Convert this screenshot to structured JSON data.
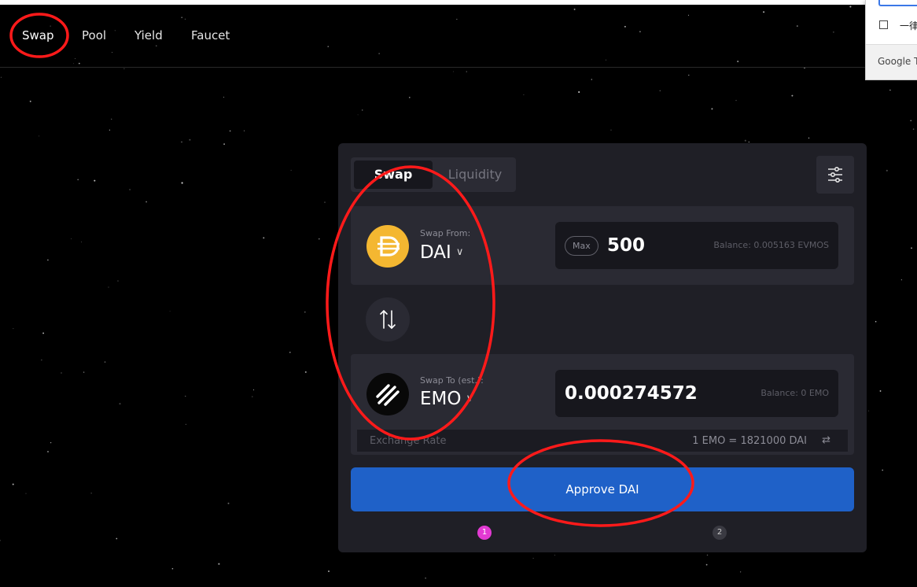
{
  "nav": {
    "items": [
      {
        "label": "Swap",
        "active": true
      },
      {
        "label": "Pool",
        "active": false
      },
      {
        "label": "Yield",
        "active": false
      },
      {
        "label": "Faucet",
        "active": false
      }
    ]
  },
  "translate_popup": {
    "checkbox_label": "一律",
    "brand": "Google Tr"
  },
  "swap_card": {
    "tabs": {
      "swap": "Swap",
      "liquidity": "Liquidity"
    },
    "settings_icon": "sliders-icon",
    "from": {
      "label": "Swap From:",
      "token": "DAI",
      "max_label": "Max",
      "amount": "500",
      "balance": "Balance: 0.005163 EVMOS"
    },
    "to": {
      "label": "Swap To (est.):",
      "token": "EMO",
      "amount": "0.000274572",
      "balance": "Balance: 0 EMO"
    },
    "exchange_rate": {
      "label": "Exchange Rate",
      "value": "1 EMO = 1821000 DAI"
    },
    "approve_label": "Approve DAI",
    "steps": [
      "1",
      "2"
    ]
  },
  "colors": {
    "background": "#000000",
    "card": "#1f1f26",
    "panel": "#2a2a33",
    "approve": "#1f61c8",
    "step_active": "#e23ad3",
    "dai": "#f4b731",
    "annotation": "#ff1a1a"
  }
}
